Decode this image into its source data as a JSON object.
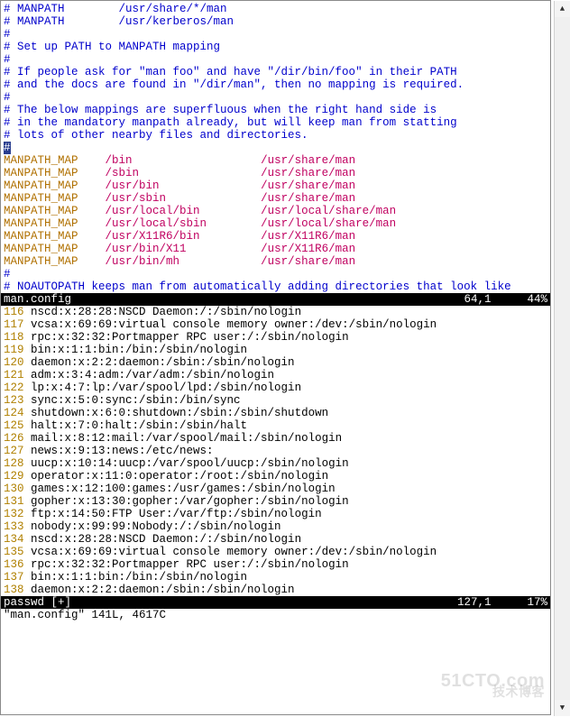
{
  "top_comments": [
    "# MANPATH        /usr/share/*/man",
    "# MANPATH        /usr/kerberos/man",
    "#",
    "# Set up PATH to MANPATH mapping",
    "#",
    "# If people ask for \"man foo\" and have \"/dir/bin/foo\" in their PATH",
    "# and the docs are found in \"/dir/man\", then no mapping is required.",
    "#",
    "# The below mappings are superfluous when the right hand side is",
    "# in the mandatory manpath already, but will keep man from statting",
    "# lots of other nearby files and directories."
  ],
  "cursor_line_prefix": "#",
  "maps": [
    {
      "k": "MANPATH_MAP",
      "p1": "/bin",
      "p2": "/usr/share/man"
    },
    {
      "k": "MANPATH_MAP",
      "p1": "/sbin",
      "p2": "/usr/share/man"
    },
    {
      "k": "MANPATH_MAP",
      "p1": "/usr/bin",
      "p2": "/usr/share/man"
    },
    {
      "k": "MANPATH_MAP",
      "p1": "/usr/sbin",
      "p2": "/usr/share/man"
    },
    {
      "k": "MANPATH_MAP",
      "p1": "/usr/local/bin",
      "p2": "/usr/local/share/man"
    },
    {
      "k": "MANPATH_MAP",
      "p1": "/usr/local/sbin",
      "p2": "/usr/local/share/man"
    },
    {
      "k": "MANPATH_MAP",
      "p1": "/usr/X11R6/bin",
      "p2": "/usr/X11R6/man"
    },
    {
      "k": "MANPATH_MAP",
      "p1": "/usr/bin/X11",
      "p2": "/usr/X11R6/man"
    },
    {
      "k": "MANPATH_MAP",
      "p1": "/usr/bin/mh",
      "p2": "/usr/share/man"
    }
  ],
  "trailing_comments": [
    "#",
    "# NOAUTOPATH keeps man from automatically adding directories that look like"
  ],
  "status_top": {
    "file": "man.config",
    "pos": "64,1",
    "pct": "44%"
  },
  "passwd_lines": [
    {
      "n": "116",
      "t": "nscd:x:28:28:NSCD Daemon:/:/sbin/nologin"
    },
    {
      "n": "117",
      "t": "vcsa:x:69:69:virtual console memory owner:/dev:/sbin/nologin"
    },
    {
      "n": "118",
      "t": "rpc:x:32:32:Portmapper RPC user:/:/sbin/nologin"
    },
    {
      "n": "119",
      "t": "bin:x:1:1:bin:/bin:/sbin/nologin"
    },
    {
      "n": "120",
      "t": "daemon:x:2:2:daemon:/sbin:/sbin/nologin"
    },
    {
      "n": "121",
      "t": "adm:x:3:4:adm:/var/adm:/sbin/nologin"
    },
    {
      "n": "122",
      "t": "lp:x:4:7:lp:/var/spool/lpd:/sbin/nologin"
    },
    {
      "n": "123",
      "t": "sync:x:5:0:sync:/sbin:/bin/sync"
    },
    {
      "n": "124",
      "t": "shutdown:x:6:0:shutdown:/sbin:/sbin/shutdown"
    },
    {
      "n": "125",
      "t": "halt:x:7:0:halt:/sbin:/sbin/halt"
    },
    {
      "n": "126",
      "t": "mail:x:8:12:mail:/var/spool/mail:/sbin/nologin"
    },
    {
      "n": "127",
      "t": "news:x:9:13:news:/etc/news:"
    },
    {
      "n": "128",
      "t": "uucp:x:10:14:uucp:/var/spool/uucp:/sbin/nologin"
    },
    {
      "n": "129",
      "t": "operator:x:11:0:operator:/root:/sbin/nologin"
    },
    {
      "n": "130",
      "t": "games:x:12:100:games:/usr/games:/sbin/nologin"
    },
    {
      "n": "131",
      "t": "gopher:x:13:30:gopher:/var/gopher:/sbin/nologin"
    },
    {
      "n": "132",
      "t": "ftp:x:14:50:FTP User:/var/ftp:/sbin/nologin"
    },
    {
      "n": "133",
      "t": "nobody:x:99:99:Nobody:/:/sbin/nologin"
    },
    {
      "n": "134",
      "t": "nscd:x:28:28:NSCD Daemon:/:/sbin/nologin"
    },
    {
      "n": "135",
      "t": "vcsa:x:69:69:virtual console memory owner:/dev:/sbin/nologin"
    },
    {
      "n": "136",
      "t": "rpc:x:32:32:Portmapper RPC user:/:/sbin/nologin"
    },
    {
      "n": "137",
      "t": "bin:x:1:1:bin:/bin:/sbin/nologin"
    },
    {
      "n": "138",
      "t": "daemon:x:2:2:daemon:/sbin:/sbin/nologin"
    }
  ],
  "status_bot": {
    "file": "passwd [+]",
    "pos": "127,1",
    "pct": "17%"
  },
  "cmdline": "\"man.config\" 141L, 4617C",
  "watermark": {
    "main": "51CTO.com",
    "sub": "技术博客"
  },
  "scroll": {
    "up": "▲",
    "down": "▼"
  }
}
